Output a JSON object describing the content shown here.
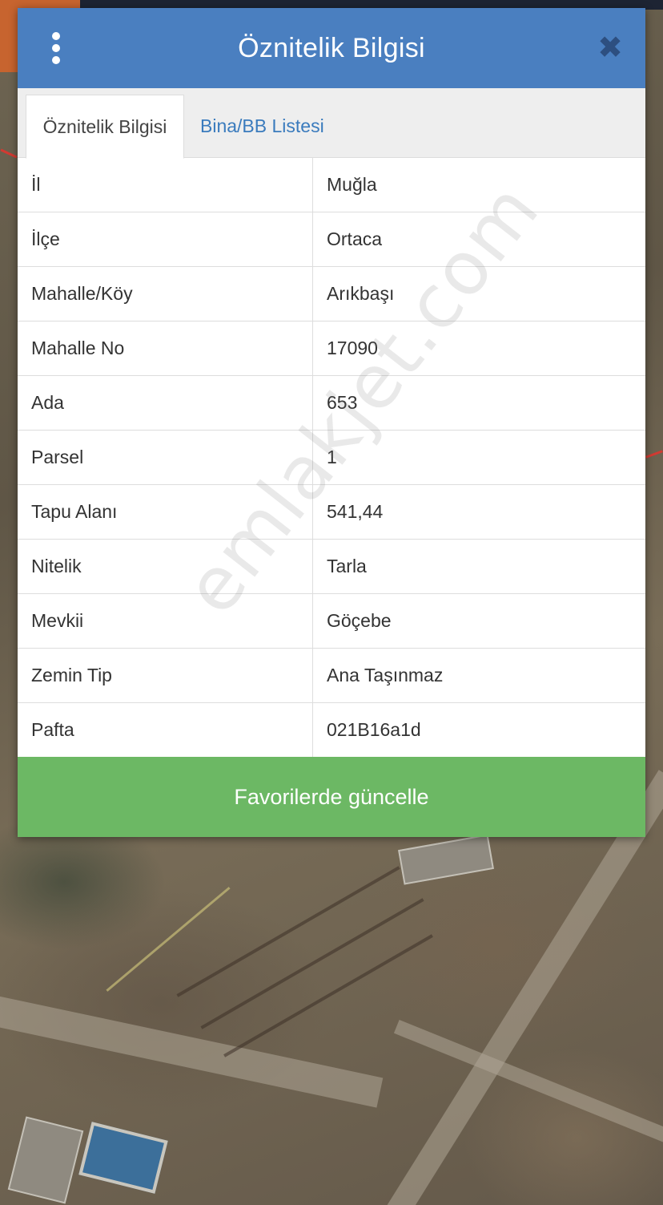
{
  "header": {
    "title": "Öznitelik Bilgisi",
    "close_glyph": "✖"
  },
  "tabs": [
    {
      "label": "Öznitelik Bilgisi",
      "active": true
    },
    {
      "label": "Bina/BB Listesi",
      "active": false
    }
  ],
  "attributes": [
    {
      "key": "İl",
      "value": "Muğla"
    },
    {
      "key": "İlçe",
      "value": "Ortaca"
    },
    {
      "key": "Mahalle/Köy",
      "value": "Arıkbaşı"
    },
    {
      "key": "Mahalle No",
      "value": "17090"
    },
    {
      "key": "Ada",
      "value": "653"
    },
    {
      "key": "Parsel",
      "value": "1"
    },
    {
      "key": "Tapu Alanı",
      "value": "541,44"
    },
    {
      "key": "Nitelik",
      "value": "Tarla"
    },
    {
      "key": "Mevkii",
      "value": "Göçebe"
    },
    {
      "key": "Zemin Tip",
      "value": "Ana Taşınmaz"
    },
    {
      "key": "Pafta",
      "value": "021B16a1d"
    }
  ],
  "footer": {
    "button_label": "Favorilerde güncelle"
  },
  "watermark": "emlakjet.com",
  "colors": {
    "header_bg": "#4a7fc0",
    "tab_link": "#3a7bbd",
    "button_bg": "#6cb864"
  }
}
